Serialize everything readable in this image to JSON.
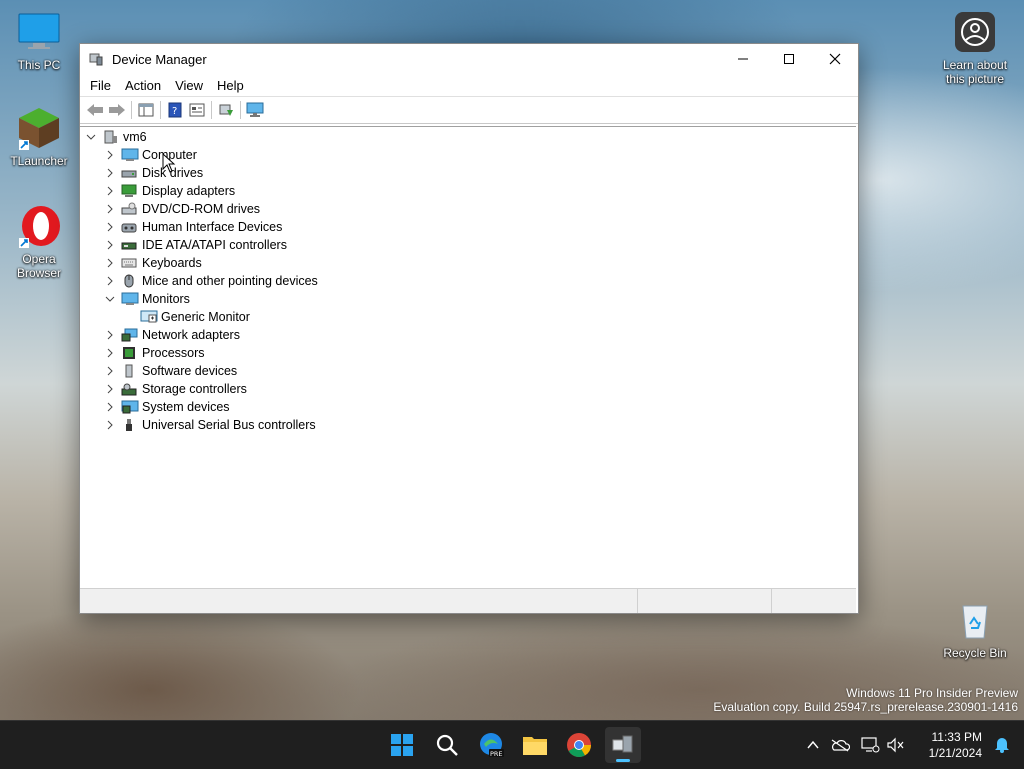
{
  "desktop": {
    "icons": [
      {
        "label": "This PC",
        "icon": "monitor-icon"
      },
      {
        "label": "TLauncher",
        "icon": "minecraft-block-icon"
      },
      {
        "label": "Opera Browser",
        "icon": "opera-icon"
      },
      {
        "label": "Learn about this picture",
        "icon": "camera-icon"
      },
      {
        "label": "Recycle Bin",
        "icon": "recycle-bin-icon"
      }
    ]
  },
  "window": {
    "title": "Device Manager",
    "menu": [
      "File",
      "Action",
      "View",
      "Help"
    ],
    "tree": {
      "root": "vm6",
      "categories": [
        {
          "label": "Computer",
          "expanded": false
        },
        {
          "label": "Disk drives",
          "expanded": false
        },
        {
          "label": "Display adapters",
          "expanded": false
        },
        {
          "label": "DVD/CD-ROM drives",
          "expanded": false
        },
        {
          "label": "Human Interface Devices",
          "expanded": false
        },
        {
          "label": "IDE ATA/ATAPI controllers",
          "expanded": false
        },
        {
          "label": "Keyboards",
          "expanded": false
        },
        {
          "label": "Mice and other pointing devices",
          "expanded": false
        },
        {
          "label": "Monitors",
          "expanded": true,
          "children": [
            "Generic Monitor"
          ]
        },
        {
          "label": "Network adapters",
          "expanded": false
        },
        {
          "label": "Processors",
          "expanded": false
        },
        {
          "label": "Software devices",
          "expanded": false
        },
        {
          "label": "Storage controllers",
          "expanded": false
        },
        {
          "label": "System devices",
          "expanded": false
        },
        {
          "label": "Universal Serial Bus controllers",
          "expanded": false
        }
      ]
    }
  },
  "watermark": {
    "line1": "Windows 11 Pro Insider Preview",
    "line2": "Evaluation copy. Build 25947.rs_prerelease.230901-1416"
  },
  "taskbar": {
    "apps": [
      "start-icon",
      "search-icon",
      "edge-pre-icon",
      "file-explorer-icon",
      "chrome-icon",
      "device-manager-icon"
    ],
    "clock": {
      "time": "11:33 PM",
      "date": "1/21/2024"
    }
  },
  "colors": {
    "accent": "#0078d4",
    "taskbar": "#1f1f1f"
  }
}
